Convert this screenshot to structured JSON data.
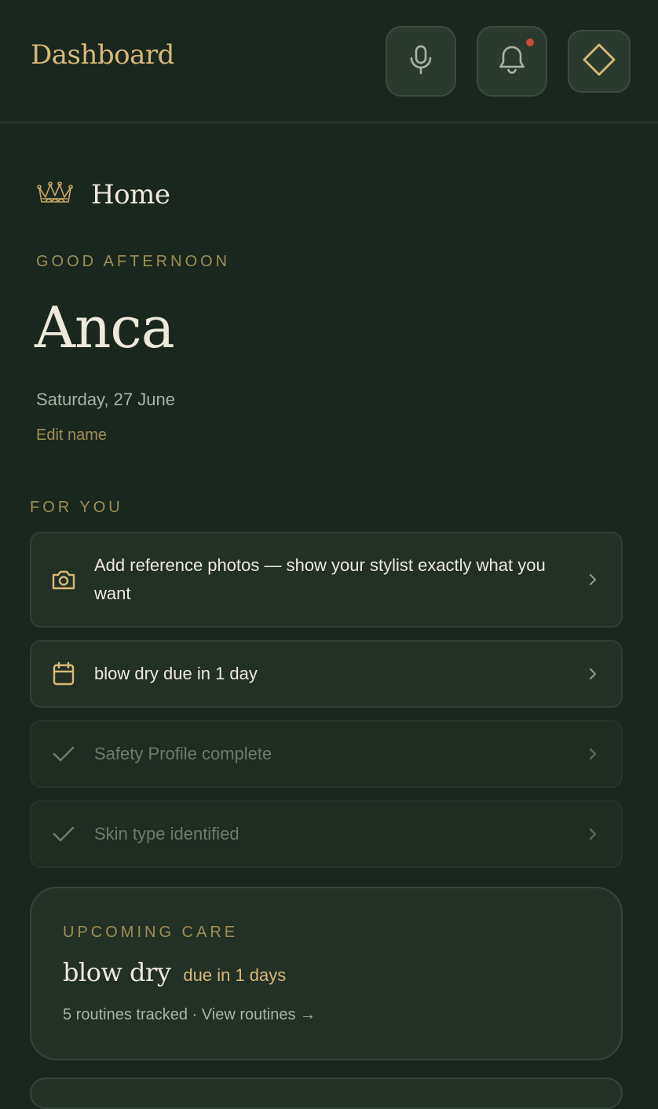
{
  "header": {
    "title": "Dashboard",
    "buttons": [
      {
        "icon": "microphone-icon"
      },
      {
        "icon": "bell-icon",
        "has_notification": true
      },
      {
        "icon": "diamond-icon"
      }
    ]
  },
  "home": {
    "icon": "crown-icon",
    "label": "Home",
    "greeting": "GOOD AFTERNOON",
    "user_name": "Anca",
    "date": "Saturday, 27 June",
    "edit_name": "Edit name"
  },
  "for_you": {
    "title": "FOR YOU",
    "items": [
      {
        "icon": "camera-icon",
        "text": "Add reference photos — show your stylist exactly what you want",
        "completed": false
      },
      {
        "icon": "calendar-icon",
        "text": "blow dry due in 1 day",
        "completed": false
      },
      {
        "icon": "check-icon",
        "text": "Safety Profile complete",
        "completed": true
      },
      {
        "icon": "check-icon",
        "text": "Skin type identified",
        "completed": true
      }
    ]
  },
  "upcoming_care": {
    "label": "UPCOMING CARE",
    "routine": "blow dry",
    "due": "due in 1 days",
    "summary": "5 routines tracked",
    "separator": "·",
    "link": "View routines →"
  },
  "colors": {
    "background": "#1a271e",
    "gold": "#d8b979",
    "muted_gold": "#a08d55",
    "text": "#efe9dc",
    "notification": "#cc4a3a"
  }
}
